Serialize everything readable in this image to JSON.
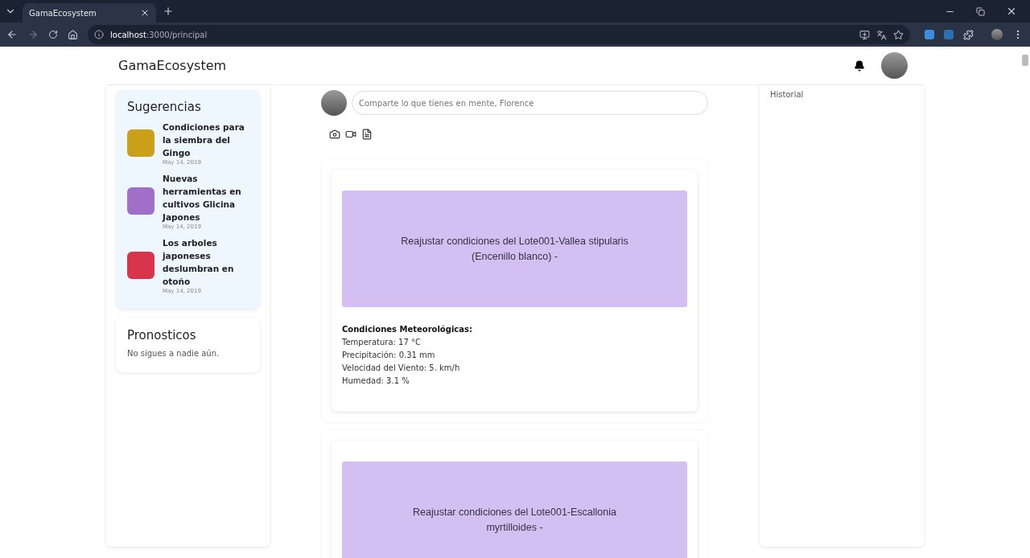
{
  "browser": {
    "tab_title": "GamaEcosystem",
    "url_host": "localhost",
    "url_path": ":3000/principal"
  },
  "header": {
    "brand": "GamaEcosystem"
  },
  "suggestions": {
    "title": "Sugerencias",
    "items": [
      {
        "title": "Condiciones para la siembra del Gingo",
        "date": "May 14, 2019",
        "color": "#c9a018"
      },
      {
        "title": "Nuevas herramientas en cultivos Glicina Japones",
        "date": "May 14, 2019",
        "color": "#a070c8"
      },
      {
        "title": "Los arboles japoneses deslumbran en otoño",
        "date": "May 14, 2019",
        "color": "#d8344c"
      }
    ]
  },
  "forecasts": {
    "title": "Pronosticos",
    "empty": "No sigues a nadie aún."
  },
  "composer": {
    "placeholder": "Comparte lo que tienes en mente, Florence"
  },
  "posts": [
    {
      "banner": "Reajustar condiciones del Lote001-Vallea stipularis (Encenillo blanco) -",
      "heading": "Condiciones Meteorológicas:",
      "lines": [
        "Temperatura: 17 °C",
        "Precipitación: 0.31 mm",
        "Velocidad del Viento: 5. km/h",
        "Humedad: 3.1 %"
      ]
    },
    {
      "banner": "Reajustar condiciones del Lote001-Escallonia myrtilloides -"
    }
  ],
  "history": {
    "title": "Historial"
  }
}
